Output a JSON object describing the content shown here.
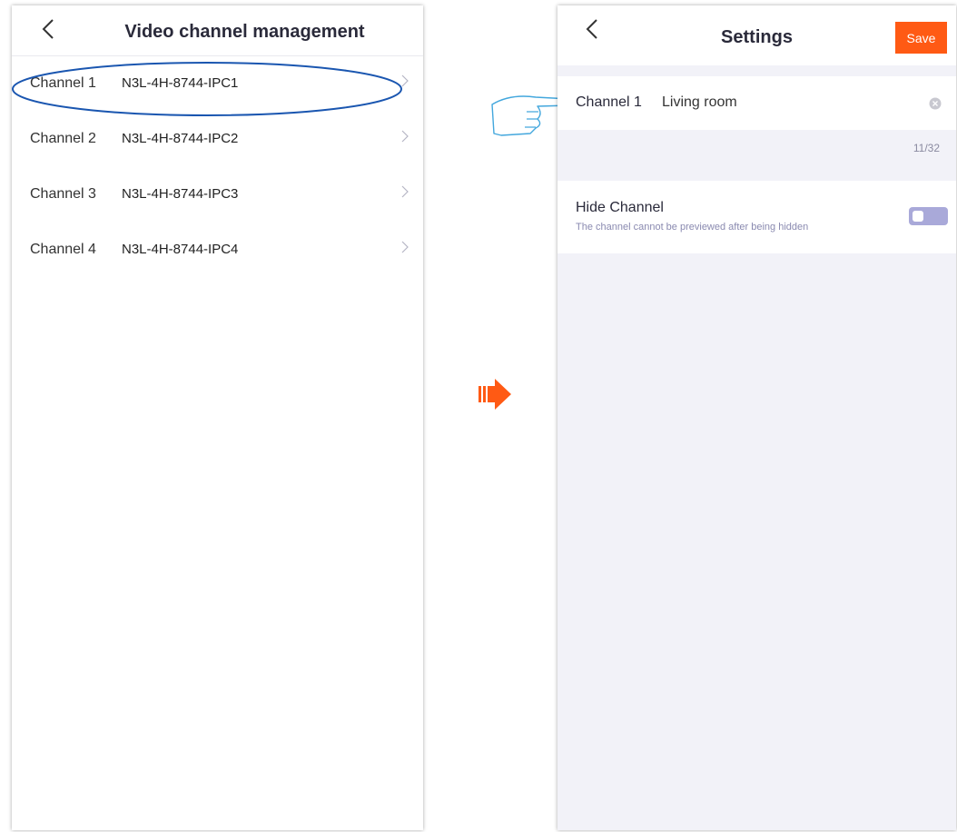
{
  "left_screen": {
    "title": "Video channel management",
    "channels": [
      {
        "label": "Channel 1",
        "name": "N3L-4H-8744-IPC1"
      },
      {
        "label": "Channel 2",
        "name": "N3L-4H-8744-IPC2"
      },
      {
        "label": "Channel 3",
        "name": "N3L-4H-8744-IPC3"
      },
      {
        "label": "Channel 4",
        "name": "N3L-4H-8744-IPC4"
      }
    ]
  },
  "right_screen": {
    "title": "Settings",
    "save_label": "Save",
    "channel_label": "Channel 1",
    "channel_name_value": "Living room",
    "char_counter": "11/32",
    "hide_channel": {
      "title": "Hide Channel",
      "description": "The channel cannot be previewed after being hidden",
      "enabled": false
    }
  },
  "colors": {
    "accent": "#ff5a14",
    "highlight_ellipse": "#1a56b0",
    "pointer_hand": "#43a7dd",
    "toggle_off": "#a9a9d9",
    "settings_background": "#f2f2f8"
  },
  "icons": {
    "back": "chevron-left-icon",
    "row_arrow": "chevron-right-icon",
    "clear": "clear-circle-icon",
    "transition": "arrow-right-icon",
    "pointer": "pointing-hand-icon"
  }
}
